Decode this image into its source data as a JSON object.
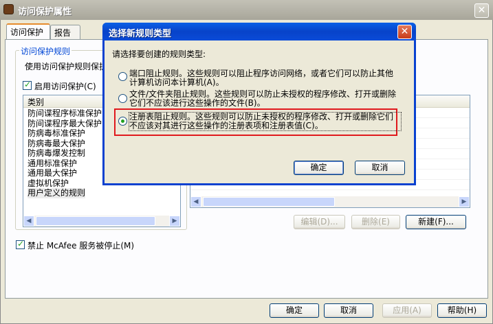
{
  "window": {
    "title": "访问保护属性",
    "close_glyph": "✕",
    "tabs": [
      "访问保护",
      "报告"
    ],
    "group_title": "访问保护规则",
    "description": "使用访问保护规则保护",
    "enable_checkbox": "启用访问保护(C)",
    "category_header": "类别",
    "categories": [
      "防间谍程序标准保护",
      "防间谍程序最大保护",
      "防病毒标准保护",
      "防病毒最大保护",
      "防病毒爆发控制",
      "通用标准保护",
      "通用最大保护",
      "虚拟机保护",
      "用户定义的规则"
    ],
    "buttons": {
      "edit": "编辑(D)...",
      "delete": "删除(E)",
      "new": "新建(F)..."
    },
    "mcafee_checkbox": "禁止 McAfee 服务被停止(M)",
    "footer": {
      "ok": "确定",
      "cancel": "取消",
      "apply": "应用(A)",
      "help": "帮助(H)"
    }
  },
  "dialog": {
    "title": "选择新规则类型",
    "close_glyph": "✕",
    "prompt": "请选择要创建的规则类型:",
    "options": [
      {
        "line1": "端口阻止规则。这些规则可以阻止程序访问网络，或者它们可以防止其他",
        "line2": "计算机访问本计算机(A)。",
        "selected": false
      },
      {
        "line1": "文件/文件夹阻止规则。这些规则可以防止未授权的程序修改、打开或删除",
        "line2": "它们不应该进行这些操作的文件(B)。",
        "selected": false
      },
      {
        "line1": "注册表阻止规则。这些规则可以防止未授权的程序修改、打开或删除它们",
        "line2": "不应该对其进行这些操作的注册表项和注册表值(C)。",
        "selected": true
      }
    ],
    "ok": "确定",
    "cancel": "取消"
  },
  "colors": {
    "highlight_border": "#e0181c",
    "dialog_title": "#0a4bd8",
    "link_blue": "#0046d5"
  }
}
